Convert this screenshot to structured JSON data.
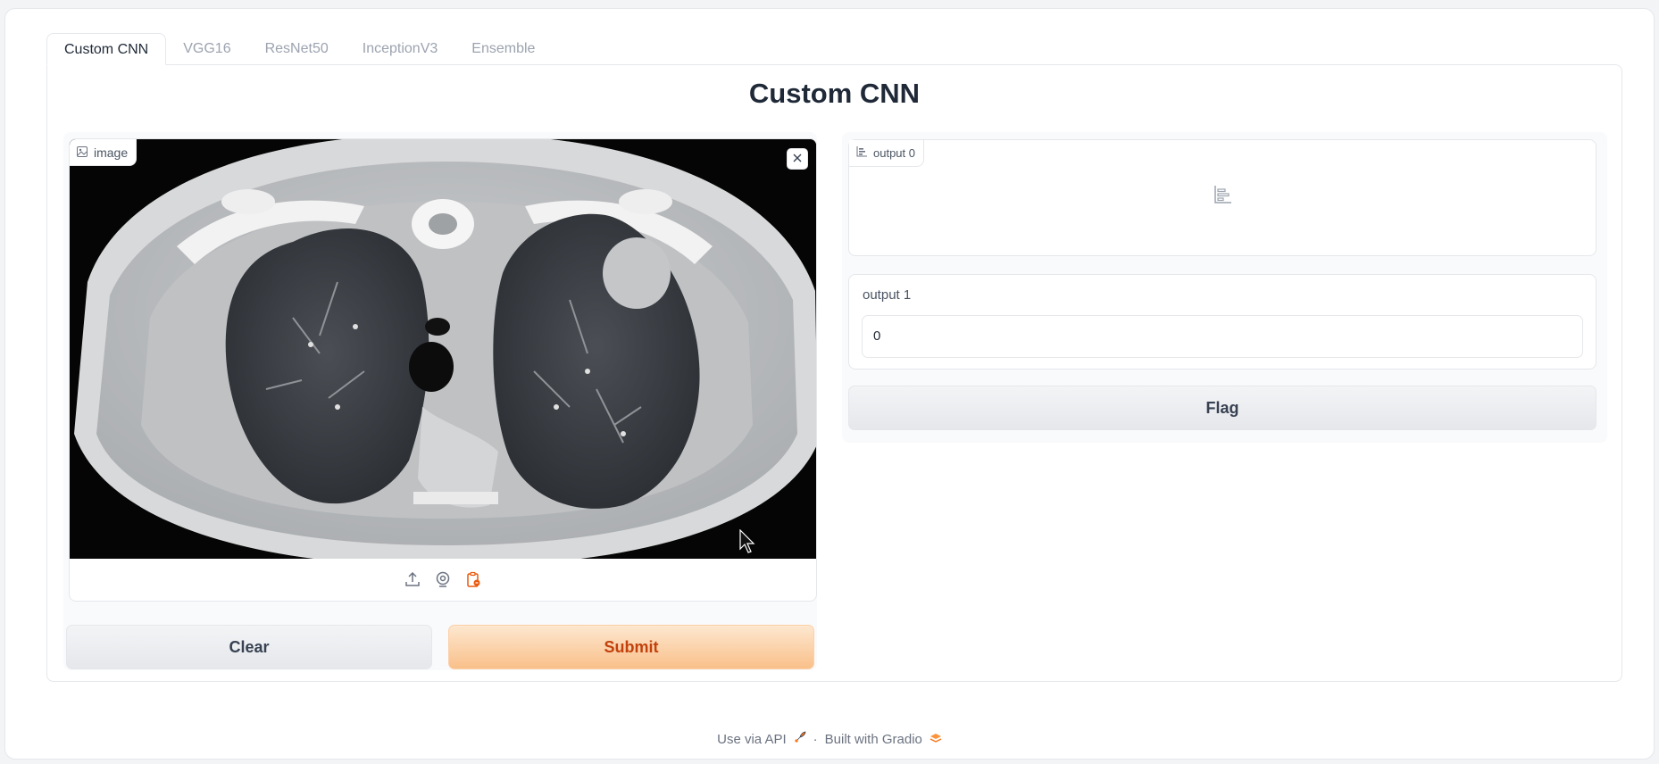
{
  "tabs": [
    {
      "label": "Custom CNN",
      "active": true
    },
    {
      "label": "VGG16",
      "active": false
    },
    {
      "label": "ResNet50",
      "active": false
    },
    {
      "label": "InceptionV3",
      "active": false
    },
    {
      "label": "Ensemble",
      "active": false
    }
  ],
  "panel": {
    "title": "Custom CNN"
  },
  "input_image": {
    "label": "image",
    "label_icon": "image-icon",
    "content_icon": "chest-ct-scan-image"
  },
  "source_icons": [
    "upload-icon",
    "webcam-icon",
    "clipboard-icon"
  ],
  "buttons": {
    "clear": "Clear",
    "submit": "Submit",
    "flag": "Flag"
  },
  "output0": {
    "label": "output 0",
    "icon": "bar-chart-icon"
  },
  "output1": {
    "label": "output 1",
    "value": "0"
  },
  "footer": {
    "api": "Use via API",
    "separator": "·",
    "built": "Built with Gradio"
  },
  "colors": {
    "accent": "#f97316",
    "primary_text": "#c2410c",
    "border": "#e5e7eb"
  }
}
